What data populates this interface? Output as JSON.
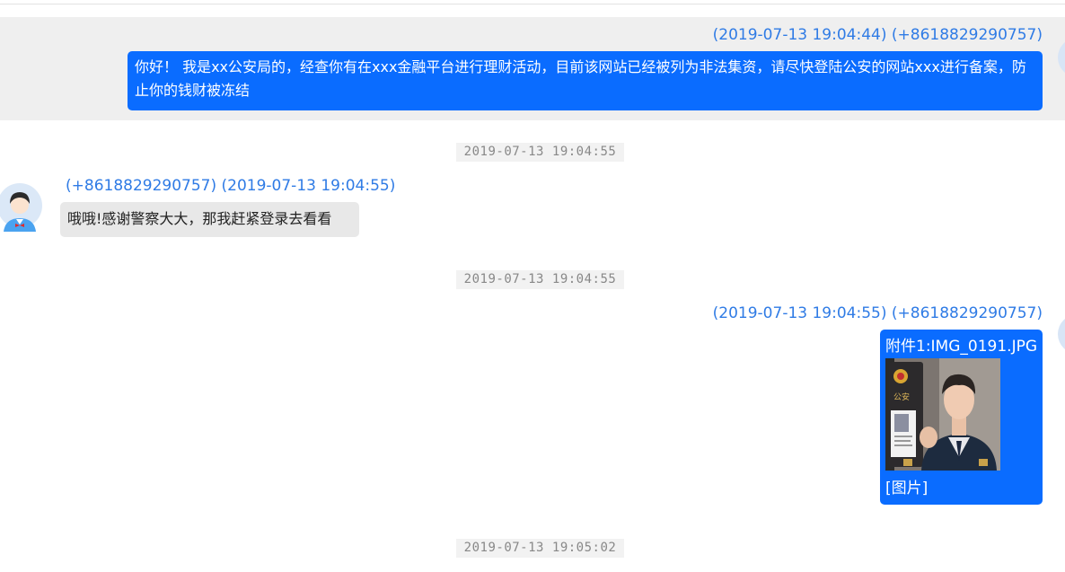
{
  "messages": [
    {
      "meta": "(2019-07-13 19:04:44) (+8618829290757)",
      "text": "你好！ 我是xx公安局的，经查你有在xxx金融平台进行理财活动，目前该网站已经被列为非法集资，请尽快登陆公安的网站xxx进行备案，防止你的钱财被冻结"
    },
    {
      "divider": "2019-07-13 19:04:55"
    },
    {
      "meta": "(+8618829290757) (2019-07-13 19:04:55)",
      "text": "哦哦!感谢警察大大，那我赶紧登录去看看"
    },
    {
      "divider": "2019-07-13 19:04:55"
    },
    {
      "meta": "(2019-07-13 19:04:55) (+8618829290757)",
      "attachment_label": "附件1:IMG_0191.JPG",
      "image_caption": "[图片]"
    },
    {
      "divider": "2019-07-13 19:05:02"
    }
  ],
  "colors": {
    "outgoing_bubble": "#0a6cff",
    "incoming_bubble": "#e8e8e8",
    "meta_text": "#2f7be5",
    "highlight_row": "#efefef"
  },
  "icons": {
    "incoming_avatar": "cartoon-person-avatar-icon",
    "outgoing_avatar": "avatar-icon"
  },
  "photo_text": {
    "badge_label": "公安"
  }
}
